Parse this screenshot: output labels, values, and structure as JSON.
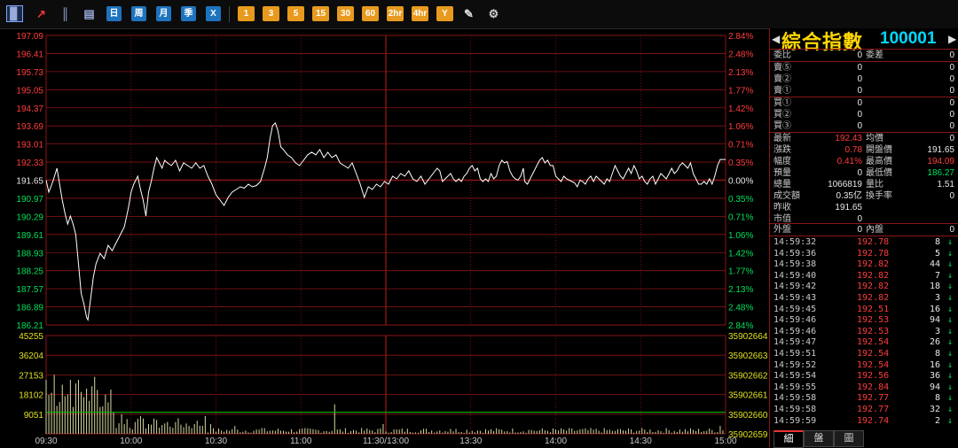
{
  "toolbar": {
    "buttons": [
      {
        "name": "chart-icon",
        "label": "▊"
      },
      {
        "name": "line-icon",
        "label": "↗"
      },
      {
        "name": "candle-icon",
        "label": "║"
      },
      {
        "name": "calendar-icon",
        "label": "▤"
      },
      {
        "name": "day-button",
        "label": "日"
      },
      {
        "name": "week-button",
        "label": "周"
      },
      {
        "name": "month-button",
        "label": "月"
      },
      {
        "name": "season-button",
        "label": "季"
      },
      {
        "name": "x-button",
        "label": "X"
      },
      {
        "name": "1min-button",
        "label": "1"
      },
      {
        "name": "3min-button",
        "label": "3"
      },
      {
        "name": "5min-button",
        "label": "5"
      },
      {
        "name": "15min-button",
        "label": "15"
      },
      {
        "name": "30min-button",
        "label": "30"
      },
      {
        "name": "60min-button",
        "label": "60"
      },
      {
        "name": "2hr-button",
        "label": "2hr"
      },
      {
        "name": "4hr-button",
        "label": "4hr"
      },
      {
        "name": "year-button",
        "label": "Y"
      },
      {
        "name": "draw-icon",
        "label": "✎"
      },
      {
        "name": "gear-icon",
        "label": "⚙"
      }
    ]
  },
  "colors": {
    "grid": "#8a1515",
    "price_line": "#ffffff",
    "up": "#ff3c3c",
    "down": "#00e05a",
    "vol_bar": "#d8d8a0",
    "baseline": "#00c800"
  },
  "chart_data": {
    "type": "line",
    "price_axis_left": [
      "197.09",
      "196.41",
      "195.73",
      "195.05",
      "194.37",
      "193.69",
      "193.01",
      "192.33",
      "191.65",
      "190.97",
      "190.29",
      "189.61",
      "188.93",
      "188.25",
      "187.57",
      "186.89",
      "186.21"
    ],
    "pct_axis_right": [
      "2.84%",
      "2.48%",
      "2.13%",
      "1.77%",
      "1.42%",
      "1.06%",
      "0.71%",
      "0.35%",
      "0.00%",
      "0.35%",
      "0.71%",
      "1.06%",
      "1.42%",
      "1.77%",
      "2.13%",
      "2.48%",
      "2.84%"
    ],
    "volume_axis_left": [
      "45255",
      "36204",
      "27153",
      "18102",
      "9051"
    ],
    "volume_axis_right": [
      "35902664",
      "35902663",
      "35902662",
      "35902661",
      "35902660",
      "35902659"
    ],
    "time_axis": [
      "09:30",
      "10:00",
      "10:30",
      "11:00",
      "11:30/13:00",
      "13:30",
      "14:00",
      "14:30",
      "15:00"
    ],
    "ylim": [
      186.21,
      197.09
    ],
    "prev_close": 191.65,
    "vol_max": 45255,
    "price_keypoints": [
      [
        0,
        191.65
      ],
      [
        2,
        191.2
      ],
      [
        5,
        191.6
      ],
      [
        8,
        192.1
      ],
      [
        10,
        191.5
      ],
      [
        12,
        190.9
      ],
      [
        14,
        190.4
      ],
      [
        16,
        190.0
      ],
      [
        18,
        190.3
      ],
      [
        20,
        190.0
      ],
      [
        22,
        189.6
      ],
      [
        24,
        188.5
      ],
      [
        26,
        187.4
      ],
      [
        28,
        187.0
      ],
      [
        30,
        186.5
      ],
      [
        31,
        186.4
      ],
      [
        33,
        187.2
      ],
      [
        35,
        188.0
      ],
      [
        37,
        188.5
      ],
      [
        40,
        188.9
      ],
      [
        43,
        188.7
      ],
      [
        46,
        189.2
      ],
      [
        49,
        189.0
      ],
      [
        52,
        189.3
      ],
      [
        55,
        189.6
      ],
      [
        58,
        189.9
      ],
      [
        61,
        190.6
      ],
      [
        63,
        191.2
      ],
      [
        65,
        191.5
      ],
      [
        68,
        191.8
      ],
      [
        70,
        191.3
      ],
      [
        72,
        190.9
      ],
      [
        74,
        190.3
      ],
      [
        76,
        191.2
      ],
      [
        78,
        191.6
      ],
      [
        80,
        192.1
      ],
      [
        82,
        192.5
      ],
      [
        84,
        192.3
      ],
      [
        86,
        192.1
      ],
      [
        88,
        192.4
      ],
      [
        90,
        192.3
      ],
      [
        93,
        192.2
      ],
      [
        96,
        192.4
      ],
      [
        99,
        192.0
      ],
      [
        102,
        192.3
      ],
      [
        105,
        192.2
      ],
      [
        108,
        192.1
      ],
      [
        111,
        192.3
      ],
      [
        114,
        192.1
      ],
      [
        117,
        192.2
      ],
      [
        120,
        191.8
      ],
      [
        123,
        191.5
      ],
      [
        126,
        191.1
      ],
      [
        129,
        190.9
      ],
      [
        132,
        190.7
      ],
      [
        135,
        191.0
      ],
      [
        138,
        191.2
      ],
      [
        141,
        191.3
      ],
      [
        144,
        191.4
      ],
      [
        147,
        191.35
      ],
      [
        150,
        191.5
      ],
      [
        153,
        191.4
      ],
      [
        156,
        191.45
      ],
      [
        159,
        191.6
      ],
      [
        162,
        192.1
      ],
      [
        164,
        192.5
      ],
      [
        166,
        193.2
      ],
      [
        168,
        193.7
      ],
      [
        170,
        193.8
      ],
      [
        172,
        193.5
      ],
      [
        174,
        192.9
      ],
      [
        176,
        192.8
      ],
      [
        179,
        192.6
      ],
      [
        182,
        192.5
      ],
      [
        185,
        192.3
      ],
      [
        188,
        192.2
      ],
      [
        191,
        192.4
      ],
      [
        194,
        192.6
      ],
      [
        197,
        192.7
      ],
      [
        200,
        192.6
      ],
      [
        203,
        192.8
      ],
      [
        206,
        192.5
      ],
      [
        209,
        192.7
      ],
      [
        212,
        192.5
      ],
      [
        215,
        192.6
      ],
      [
        218,
        192.3
      ],
      [
        221,
        192.2
      ],
      [
        224,
        192.1
      ],
      [
        227,
        192.3
      ],
      [
        230,
        191.9
      ],
      [
        233,
        191.5
      ],
      [
        236,
        191.0
      ],
      [
        239,
        191.4
      ],
      [
        242,
        191.3
      ],
      [
        245,
        191.5
      ],
      [
        248,
        191.4
      ],
      [
        251,
        191.6
      ],
      [
        254,
        191.5
      ],
      [
        257,
        191.8
      ],
      [
        260,
        191.7
      ],
      [
        263,
        191.9
      ],
      [
        266,
        191.8
      ],
      [
        269,
        192.0
      ],
      [
        272,
        191.7
      ],
      [
        275,
        191.6
      ],
      [
        278,
        191.8
      ],
      [
        281,
        191.5
      ],
      [
        284,
        191.7
      ],
      [
        287,
        191.9
      ],
      [
        290,
        192.1
      ],
      [
        292,
        192.0
      ],
      [
        294,
        191.6
      ],
      [
        296,
        191.7
      ],
      [
        298,
        191.8
      ],
      [
        300,
        191.9
      ],
      [
        302,
        191.7
      ],
      [
        304,
        191.6
      ],
      [
        306,
        191.7
      ],
      [
        308,
        191.6
      ],
      [
        310,
        191.8
      ],
      [
        312,
        191.9
      ],
      [
        314,
        192.1
      ],
      [
        316,
        192.2
      ],
      [
        318,
        192.0
      ],
      [
        320,
        192.1
      ],
      [
        322,
        191.7
      ],
      [
        324,
        191.6
      ],
      [
        326,
        191.7
      ],
      [
        328,
        191.6
      ],
      [
        330,
        191.9
      ],
      [
        332,
        191.7
      ],
      [
        334,
        191.8
      ],
      [
        336,
        192.2
      ],
      [
        338,
        192.4
      ],
      [
        340,
        192.3
      ],
      [
        342,
        192.35
      ],
      [
        344,
        192.0
      ],
      [
        346,
        191.8
      ],
      [
        348,
        191.7
      ],
      [
        350,
        191.65
      ],
      [
        352,
        191.8
      ],
      [
        354,
        192.1
      ],
      [
        355,
        191.6
      ],
      [
        357,
        191.5
      ],
      [
        360,
        191.8
      ],
      [
        362,
        192.0
      ],
      [
        364,
        192.2
      ],
      [
        366,
        192.4
      ],
      [
        368,
        192.5
      ],
      [
        370,
        192.3
      ],
      [
        372,
        192.4
      ],
      [
        374,
        192.2
      ],
      [
        376,
        192.2
      ],
      [
        378,
        191.8
      ],
      [
        380,
        191.7
      ],
      [
        382,
        191.6
      ],
      [
        384,
        191.8
      ],
      [
        386,
        191.7
      ],
      [
        388,
        191.65
      ],
      [
        390,
        191.6
      ],
      [
        392,
        191.55
      ],
      [
        394,
        191.4
      ],
      [
        396,
        191.65
      ],
      [
        398,
        191.6
      ],
      [
        400,
        191.5
      ],
      [
        402,
        191.7
      ],
      [
        404,
        191.8
      ],
      [
        406,
        191.6
      ],
      [
        408,
        191.8
      ],
      [
        410,
        191.7
      ],
      [
        412,
        191.6
      ],
      [
        414,
        191.5
      ],
      [
        416,
        191.7
      ],
      [
        418,
        191.6
      ],
      [
        420,
        191.9
      ],
      [
        422,
        192.2
      ],
      [
        424,
        192.0
      ],
      [
        426,
        191.8
      ],
      [
        428,
        191.7
      ],
      [
        430,
        191.9
      ],
      [
        432,
        192.1
      ],
      [
        434,
        191.9
      ],
      [
        436,
        192.2
      ],
      [
        438,
        192.0
      ],
      [
        440,
        191.7
      ],
      [
        442,
        191.8
      ],
      [
        444,
        191.6
      ],
      [
        446,
        191.5
      ],
      [
        448,
        191.7
      ],
      [
        450,
        191.8
      ],
      [
        452,
        191.5
      ],
      [
        454,
        191.7
      ],
      [
        456,
        191.9
      ],
      [
        458,
        191.8
      ],
      [
        460,
        191.7
      ],
      [
        462,
        191.9
      ],
      [
        464,
        192.1
      ],
      [
        466,
        191.9
      ],
      [
        468,
        192.0
      ],
      [
        470,
        192.2
      ],
      [
        472,
        192.3
      ],
      [
        474,
        192.2
      ],
      [
        476,
        192.1
      ],
      [
        478,
        192.3
      ],
      [
        480,
        191.9
      ],
      [
        482,
        191.7
      ],
      [
        484,
        191.5
      ],
      [
        486,
        191.5
      ],
      [
        488,
        191.6
      ],
      [
        490,
        191.5
      ],
      [
        492,
        191.7
      ],
      [
        494,
        191.5
      ],
      [
        496,
        191.8
      ],
      [
        498,
        192.2
      ],
      [
        500,
        192.43
      ],
      [
        504,
        192.43
      ]
    ],
    "volume_spikes": [
      [
        0,
        0.55
      ],
      [
        3,
        0.65
      ],
      [
        6,
        0.6
      ],
      [
        9,
        0.45
      ],
      [
        12,
        0.5
      ],
      [
        15,
        0.62
      ],
      [
        18,
        0.55
      ],
      [
        21,
        0.48
      ],
      [
        24,
        0.55
      ],
      [
        27,
        0.5
      ],
      [
        30,
        0.46
      ],
      [
        33,
        0.45
      ],
      [
        36,
        0.58
      ],
      [
        39,
        0.52
      ],
      [
        42,
        0.28
      ],
      [
        45,
        0.75
      ],
      [
        47,
        0.3
      ],
      [
        50,
        0.22
      ],
      [
        56,
        0.2
      ],
      [
        60,
        0.15
      ],
      [
        66,
        0.12
      ],
      [
        70,
        0.18
      ],
      [
        76,
        0.1
      ],
      [
        82,
        0.14
      ],
      [
        96,
        0.12
      ],
      [
        110,
        0.1
      ],
      [
        118,
        0.18
      ],
      [
        122,
        0.1
      ],
      [
        140,
        0.08
      ],
      [
        160,
        0.06
      ],
      [
        185,
        0.95
      ],
      [
        214,
        0.3
      ],
      [
        250,
        0.1
      ],
      [
        300,
        0.05
      ],
      [
        360,
        0.04
      ],
      [
        420,
        0.03
      ],
      [
        500,
        0.08
      ]
    ]
  },
  "quote": {
    "name": "綜合指數",
    "code": "100001",
    "bid_ratio_label": "委比",
    "bid_ratio": "0",
    "bid_diff_label": "委差",
    "bid_diff": "0",
    "asks": [
      {
        "label": "賣⑤",
        "vol": "0"
      },
      {
        "label": "賣②",
        "vol": "0"
      },
      {
        "label": "賣①",
        "vol": "0"
      }
    ],
    "bids": [
      {
        "label": "買①",
        "vol": "0"
      },
      {
        "label": "買②",
        "vol": "0"
      },
      {
        "label": "買③",
        "vol": "0"
      }
    ],
    "last_label": "最新",
    "last": "192.43",
    "avg_label": "均價",
    "avg": "0",
    "chg_label": "漲跌",
    "chg": "0.78",
    "open_label": "開盤價",
    "open": "191.65",
    "pct_label": "幅度",
    "pct": "0.41%",
    "high_label": "最高價",
    "high": "194.09",
    "pre_vol_label": "預量",
    "pre_vol": "0",
    "low_label": "最低價",
    "low": "186.27",
    "tot_vol_label": "總量",
    "tot_vol": "1066819",
    "vol_ratio_label": "量比",
    "vol_ratio": "1.51",
    "amount_label": "成交額",
    "amount": "0.35亿",
    "turnover_label": "換手率",
    "turnover": "0",
    "prev_label": "昨收",
    "prev": "191.65",
    "mcap_label": "市值",
    "mcap": "0",
    "outer_label": "外盤",
    "outer": "0",
    "inner_label": "內盤",
    "inner": "0"
  },
  "ticks": [
    {
      "t": "14:59:32",
      "p": "192.78",
      "v": "8",
      "d": "↓"
    },
    {
      "t": "14:59:36",
      "p": "192.78",
      "v": "5",
      "d": "↓"
    },
    {
      "t": "14:59:38",
      "p": "192.82",
      "v": "44",
      "d": "↓"
    },
    {
      "t": "14:59:40",
      "p": "192.82",
      "v": "7",
      "d": "↓"
    },
    {
      "t": "14:59:42",
      "p": "192.82",
      "v": "18",
      "d": "↓"
    },
    {
      "t": "14:59:43",
      "p": "192.82",
      "v": "3",
      "d": "↓"
    },
    {
      "t": "14:59:45",
      "p": "192.51",
      "v": "16",
      "d": "↓"
    },
    {
      "t": "14:59:46",
      "p": "192.53",
      "v": "94",
      "d": "↓"
    },
    {
      "t": "14:59:46",
      "p": "192.53",
      "v": "3",
      "d": "↓"
    },
    {
      "t": "14:59:47",
      "p": "192.54",
      "v": "26",
      "d": "↓"
    },
    {
      "t": "14:59:51",
      "p": "192.54",
      "v": "8",
      "d": "↓"
    },
    {
      "t": "14:59:52",
      "p": "192.54",
      "v": "16",
      "d": "↓"
    },
    {
      "t": "14:59:54",
      "p": "192.56",
      "v": "36",
      "d": "↓"
    },
    {
      "t": "14:59:55",
      "p": "192.84",
      "v": "94",
      "d": "↓"
    },
    {
      "t": "14:59:58",
      "p": "192.77",
      "v": "8",
      "d": "↓"
    },
    {
      "t": "14:59:58",
      "p": "192.77",
      "v": "32",
      "d": "↓"
    },
    {
      "t": "14:59:59",
      "p": "192.74",
      "v": "2",
      "d": "↓"
    }
  ],
  "tabs": [
    "細",
    "盤",
    "圖"
  ]
}
